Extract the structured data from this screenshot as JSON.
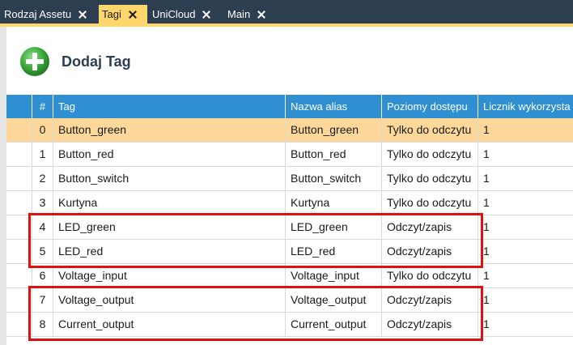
{
  "tabs": [
    {
      "label": "Rodzaj Assetu",
      "active": false
    },
    {
      "label": "Tagi",
      "active": true
    },
    {
      "label": "UniCloud",
      "active": false
    },
    {
      "label": "Main",
      "active": false
    }
  ],
  "toolbar": {
    "add_label": "Dodaj Tag"
  },
  "grid": {
    "columns": [
      "#",
      "Tag",
      "Nazwa alias",
      "Poziomy dostępu",
      "Licznik wykorzysta"
    ],
    "rows": [
      {
        "index": "0",
        "tag": "Button_green",
        "alias": "Button_green",
        "access": "Tylko do odczytu",
        "count": "1",
        "selected": true
      },
      {
        "index": "1",
        "tag": "Button_red",
        "alias": "Button_red",
        "access": "Tylko do odczytu",
        "count": "1"
      },
      {
        "index": "2",
        "tag": "Button_switch",
        "alias": "Button_switch",
        "access": "Tylko do odczytu",
        "count": "1"
      },
      {
        "index": "3",
        "tag": "Kurtyna",
        "alias": "Kurtyna",
        "access": "Tylko do odczytu",
        "count": "1"
      },
      {
        "index": "4",
        "tag": "LED_green",
        "alias": "LED_green",
        "access": "Odczyt/zapis",
        "count": "1"
      },
      {
        "index": "5",
        "tag": "LED_red",
        "alias": "LED_red",
        "access": "Odczyt/zapis",
        "count": "1"
      },
      {
        "index": "6",
        "tag": "Voltage_input",
        "alias": "Voltage_input",
        "access": "Tylko do odczytu",
        "count": "1"
      },
      {
        "index": "7",
        "tag": "Voltage_output",
        "alias": "Voltage_output",
        "access": "Odczyt/zapis",
        "count": "1"
      },
      {
        "index": "8",
        "tag": "Current_output",
        "alias": "Current_output",
        "access": "Odczyt/zapis",
        "count": "1"
      }
    ]
  },
  "colors": {
    "tabbar": "#2d3e50",
    "active_tab": "#ffd66b",
    "header": "#2f8fd1",
    "selected_row": "#fdd89a",
    "highlight": "#e01010",
    "add_icon": "#3aa83a"
  }
}
